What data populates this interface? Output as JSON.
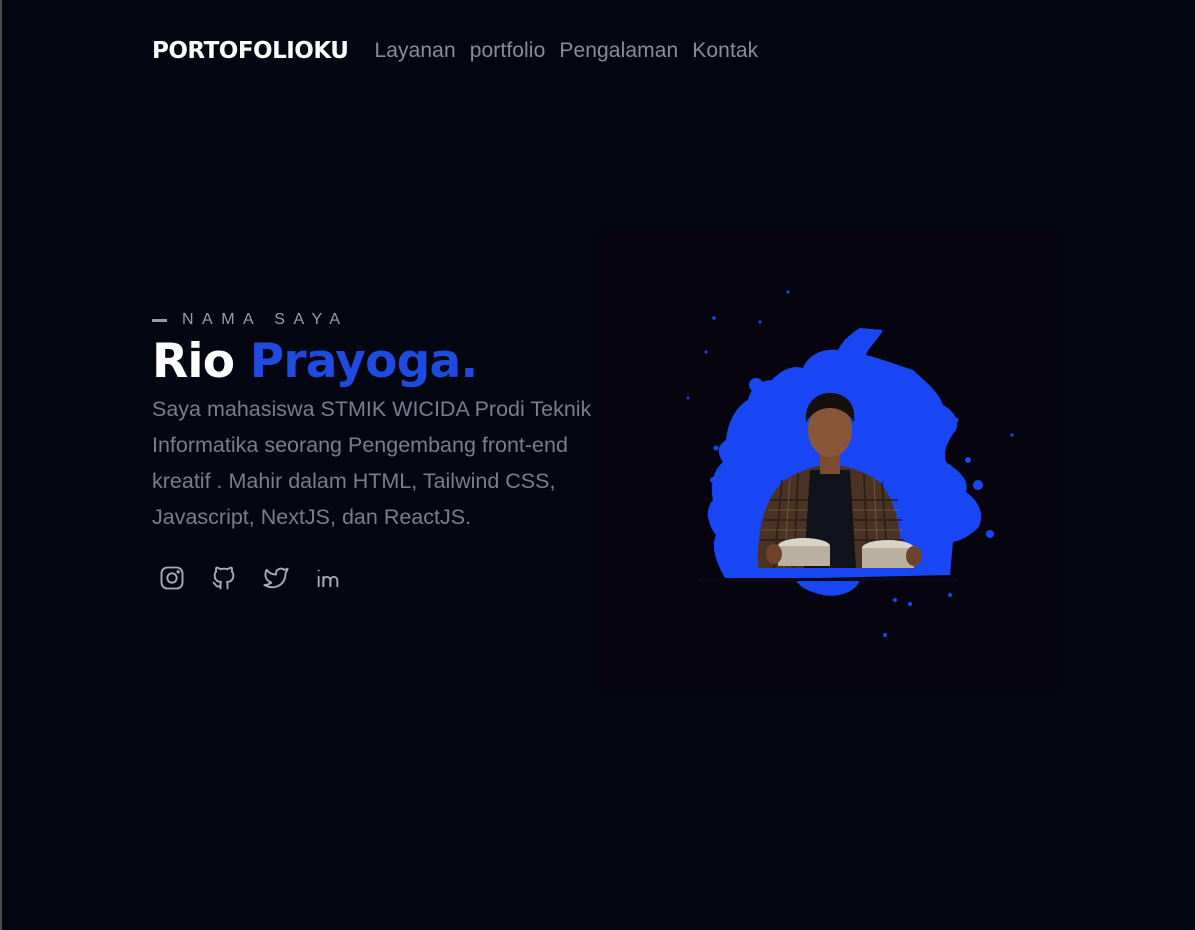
{
  "nav": {
    "brand": "PORTOFOLIOKU",
    "links": [
      "Layanan",
      "portfolio",
      "Pengalaman",
      "Kontak"
    ]
  },
  "hero": {
    "eyebrow": "NAMA SAYA",
    "first_name": "Rio",
    "last_name": "Prayoga.",
    "description": "Saya mahasiswa STMIK WICIDA Prodi Teknik Informatika seorang Pengembang front-end kreatif . Mahir dalam HTML, Tailwind CSS, Javascript, NextJS, dan ReactJS.",
    "socials": [
      "instagram-icon",
      "github-icon",
      "twitter-icon",
      "linkedin-icon"
    ]
  },
  "colors": {
    "background": "#040611",
    "accent": "#1f4be0",
    "muted_text": "#7a7d8b",
    "nav_text": "#8a8d99",
    "splash": "#1a47f5"
  }
}
